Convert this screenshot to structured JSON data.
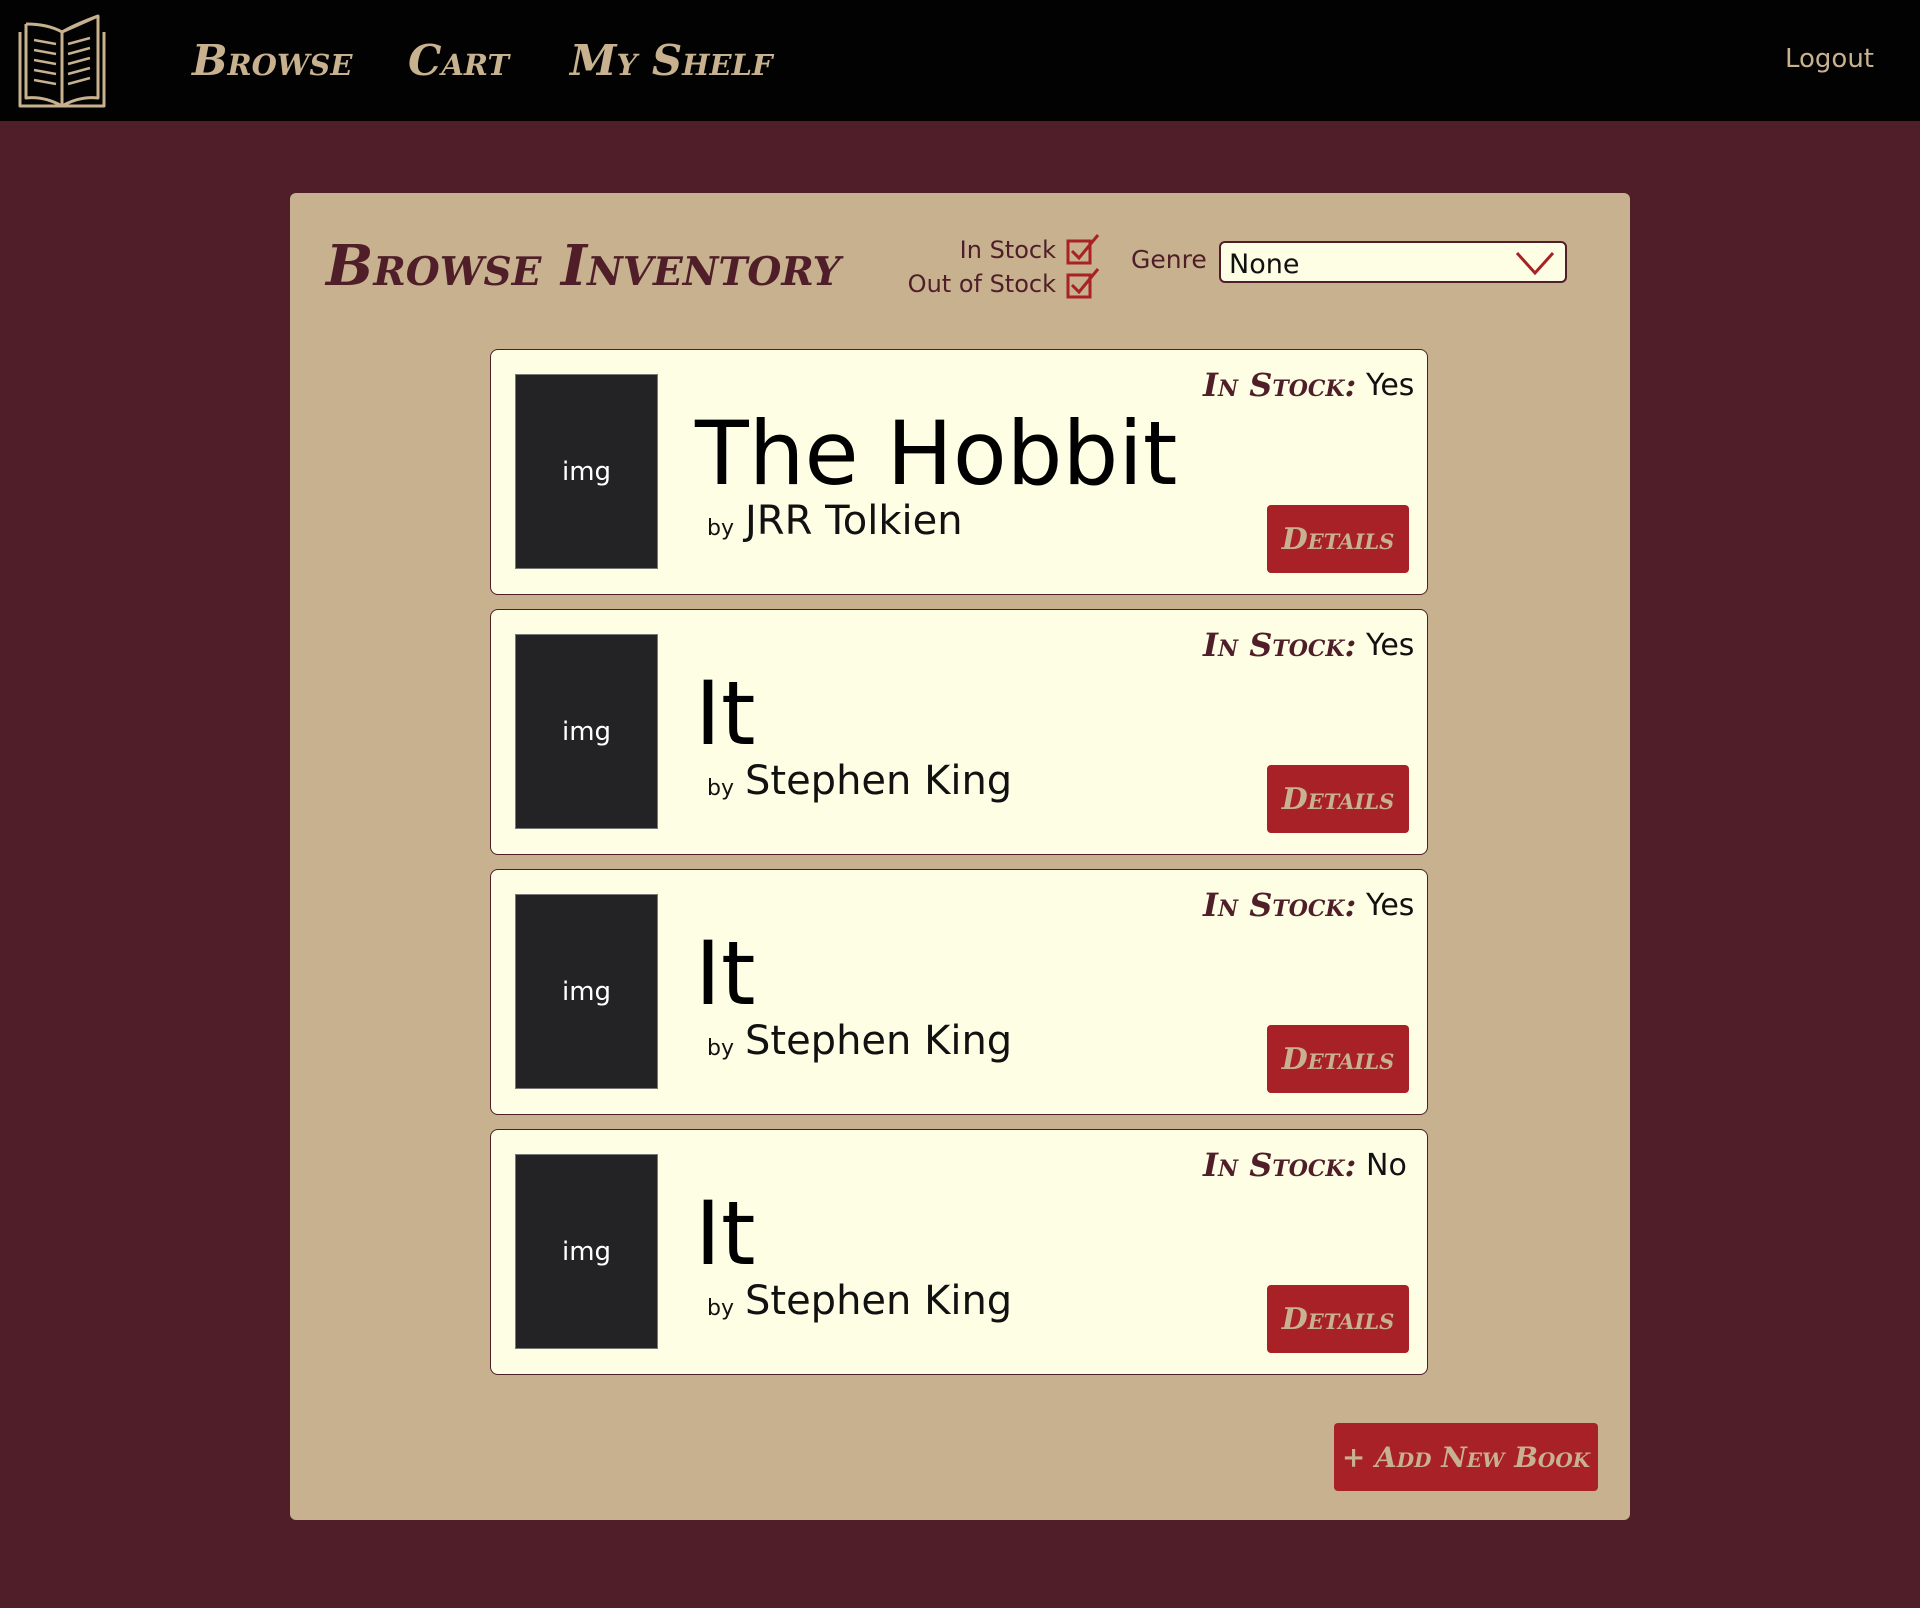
{
  "nav": {
    "logo_icon": "open-book-icon",
    "links": [
      "Browse",
      "Cart",
      "My Shelf"
    ],
    "logout": "Logout"
  },
  "inventory": {
    "title": "Browse Inventory",
    "filters": {
      "in_stock_label": "In Stock",
      "in_stock_checked": true,
      "out_of_stock_label": "Out of Stock",
      "out_of_stock_checked": true,
      "genre_label": "Genre",
      "genre_value": "None"
    },
    "stock_label": "In Stock:",
    "by_label": "by",
    "cover_placeholder": "img",
    "details_label": "Details",
    "books": [
      {
        "title": "The Hobbit",
        "author": "JRR Tolkien",
        "in_stock": "Yes"
      },
      {
        "title": "It",
        "author": "Stephen King",
        "in_stock": "Yes"
      },
      {
        "title": "It",
        "author": "Stephen King",
        "in_stock": "Yes"
      },
      {
        "title": "It",
        "author": "Stephen King",
        "in_stock": "No"
      }
    ],
    "add_button": "+ Add New Book"
  },
  "colors": {
    "background": "#4f1e29",
    "topbar": "#020202",
    "panel": "#c7b18e",
    "card": "#fdfee4",
    "accent": "#a82126",
    "text_dark": "#4f1e29"
  }
}
